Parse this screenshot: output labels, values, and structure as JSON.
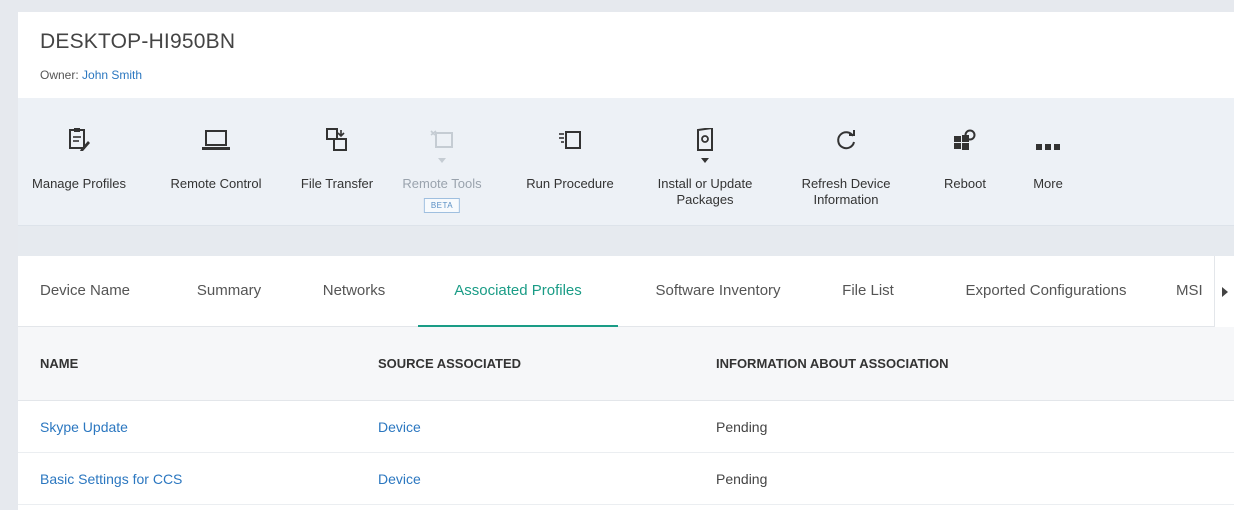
{
  "device": {
    "name": "DESKTOP-HI950BN",
    "owner_label": "Owner:",
    "owner_name": "John Smith"
  },
  "toolbar": {
    "manage_profiles": "Manage Profiles",
    "remote_control": "Remote Control",
    "file_transfer": "File Transfer",
    "remote_tools": "Remote Tools",
    "remote_tools_badge": "BETA",
    "run_procedure": "Run Procedure",
    "install_update_line1": "Install or Update",
    "install_update_line2": "Packages",
    "refresh_line1": "Refresh Device",
    "refresh_line2": "Information",
    "reboot": "Reboot",
    "more": "More"
  },
  "tabs": [
    {
      "label": "Device Name"
    },
    {
      "label": "Summary"
    },
    {
      "label": "Networks"
    },
    {
      "label": "Associated Profiles",
      "active": true
    },
    {
      "label": "Software Inventory"
    },
    {
      "label": "File List"
    },
    {
      "label": "Exported Configurations"
    },
    {
      "label": "MSI"
    }
  ],
  "table": {
    "headers": [
      "NAME",
      "SOURCE ASSOCIATED",
      "INFORMATION ABOUT ASSOCIATION"
    ],
    "rows": [
      {
        "name": "Skype Update",
        "source": "Device",
        "info": "Pending"
      },
      {
        "name": "Basic Settings for CCS",
        "source": "Device",
        "info": "Pending"
      }
    ]
  },
  "colors": {
    "accent": "#1a9c86",
    "link": "#2b77c0",
    "toolbar_bg": "#edf1f6"
  }
}
